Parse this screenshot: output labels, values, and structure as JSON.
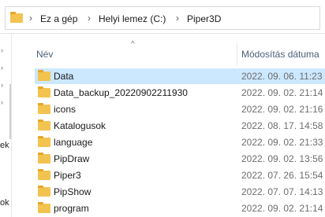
{
  "breadcrumb": {
    "items": [
      "Ez a gép",
      "Helyi lemez (C:)",
      "Piper3D"
    ],
    "separator": "›"
  },
  "left_strip": {
    "glyphs": [
      "›",
      "›",
      "›",
      "›"
    ],
    "partial_text_1": "ek",
    "partial_text_2": "ok"
  },
  "columns": {
    "name": "Név",
    "date": "Módosítás dátuma",
    "sort_indicator": "^"
  },
  "files": [
    {
      "name": "Data",
      "date": "2022. 09. 06. 11:23",
      "selected": true
    },
    {
      "name": "Data_backup_20220902211930",
      "date": "2022. 09. 02. 21:14",
      "selected": false
    },
    {
      "name": "icons",
      "date": "2022. 09. 02. 21:16",
      "selected": false
    },
    {
      "name": "Katalogusok",
      "date": "2022. 08. 17. 14:58",
      "selected": false
    },
    {
      "name": "language",
      "date": "2022. 09. 02. 21:33",
      "selected": false
    },
    {
      "name": "PipDraw",
      "date": "2022. 09. 02. 13:56",
      "selected": false
    },
    {
      "name": "Piper3",
      "date": "2022. 07. 26. 15:54",
      "selected": false
    },
    {
      "name": "PipShow",
      "date": "2022. 07. 07. 14:13",
      "selected": false
    },
    {
      "name": "program",
      "date": "2022. 09. 02. 21:14",
      "selected": false
    }
  ],
  "colors": {
    "selection": "#cce8ff",
    "folder": "#f3c350",
    "header_text": "#4c607a"
  },
  "icons": {
    "folder": "folder-icon",
    "breadcrumb_folder": "folder-icon"
  }
}
